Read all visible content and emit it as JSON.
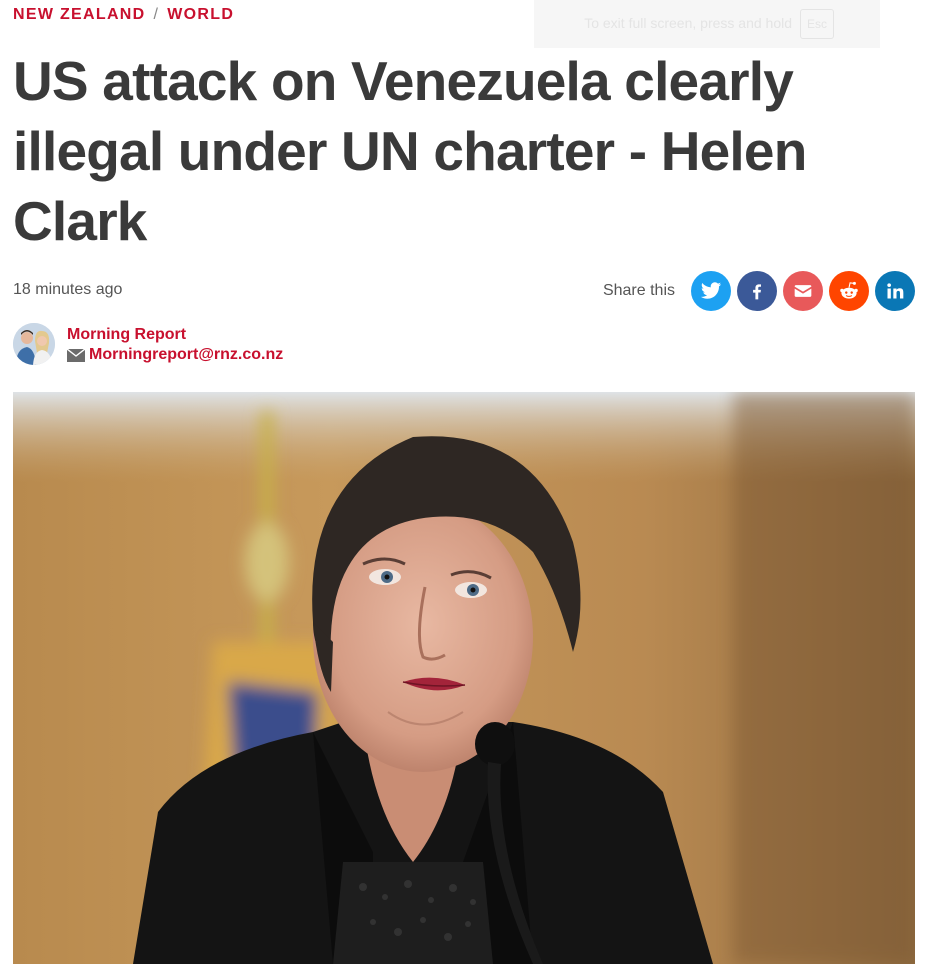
{
  "breadcrumb": {
    "section": "NEW ZEALAND",
    "separator": "/",
    "subsection": "WORLD"
  },
  "fullscreen_hint": {
    "text": "To exit full screen, press and hold",
    "key": "Esc"
  },
  "article": {
    "headline": "US attack on Venezuela clearly illegal under UN charter - Helen Clark",
    "timestamp": "18 minutes ago"
  },
  "share": {
    "label": "Share this",
    "buttons": [
      {
        "name": "twitter",
        "icon": "twitter-bird-icon",
        "color": "#1da1f2"
      },
      {
        "name": "facebook",
        "icon": "facebook-f-icon",
        "color": "#3b5998"
      },
      {
        "name": "email",
        "icon": "envelope-icon",
        "color": "#e8595a"
      },
      {
        "name": "reddit",
        "icon": "reddit-alien-icon",
        "color": "#ff4500"
      },
      {
        "name": "linkedin",
        "icon": "linkedin-in-icon",
        "color": "#0a77b5"
      }
    ]
  },
  "author": {
    "name": "Morning Report",
    "email": "Morningreport@rnz.co.nz",
    "email_icon": "envelope-icon"
  },
  "colors": {
    "accent": "#c8102e",
    "headline": "#3a3a3a",
    "muted": "#555555"
  }
}
